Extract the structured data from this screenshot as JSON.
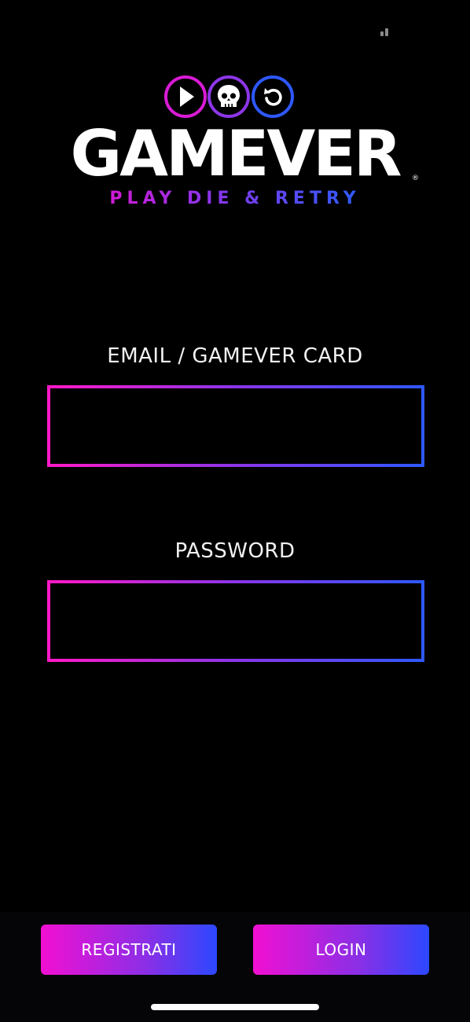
{
  "app": {
    "brand": "GAMEVER",
    "registered_mark": "®",
    "tagline": "PLAY DIE & RETRY",
    "logo_icons": [
      "play-icon",
      "skull-icon",
      "retry-icon"
    ],
    "colors": {
      "pink": "#ff19c8",
      "purple": "#8b35e8",
      "blue": "#2e58ff",
      "background": "#000000"
    }
  },
  "form": {
    "email_label": "EMAIL / GAMEVER CARD",
    "email_value": "",
    "password_label": "PASSWORD",
    "password_value": ""
  },
  "actions": {
    "register_label": "REGISTRATI",
    "login_label": "LOGIN"
  }
}
